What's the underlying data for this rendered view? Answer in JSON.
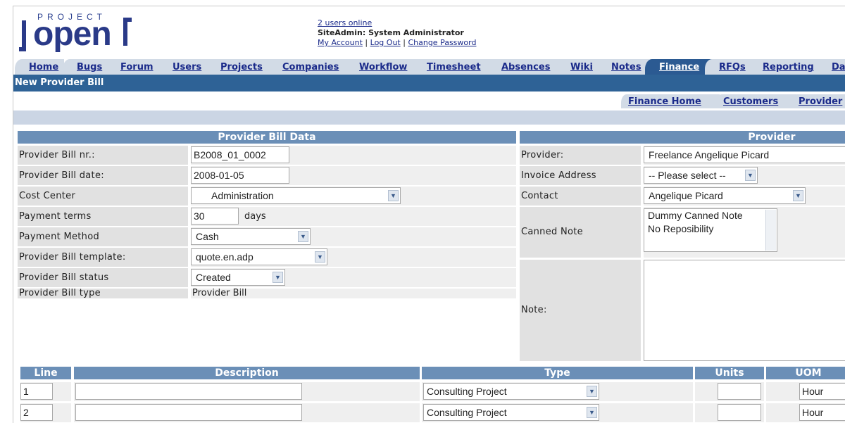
{
  "header": {
    "logo_project": "PROJECT",
    "logo_open": "open",
    "users_online": "2 users online",
    "user_line": "SiteAdmin: System Administrator",
    "my_account": "My Account",
    "logout": "Log Out",
    "change_password": "Change Password",
    "sep": "|"
  },
  "tabs": [
    {
      "label": "Home"
    },
    {
      "label": "Bugs"
    },
    {
      "label": "Forum"
    },
    {
      "label": "Users"
    },
    {
      "label": "Projects"
    },
    {
      "label": "Companies"
    },
    {
      "label": "Workflow"
    },
    {
      "label": "Timesheet"
    },
    {
      "label": "Absences"
    },
    {
      "label": "Wiki"
    },
    {
      "label": "Notes"
    },
    {
      "label": "Finance"
    },
    {
      "label": "RFQs"
    },
    {
      "label": "Reporting"
    },
    {
      "label": "Da"
    }
  ],
  "page_title": "New Provider Bill",
  "subtabs": [
    {
      "label": "Finance Home"
    },
    {
      "label": "Customers"
    },
    {
      "label": "Provider"
    }
  ],
  "bill_data": {
    "header": "Provider Bill Data",
    "nr_label": "Provider Bill nr.:",
    "nr_value": "B2008_01_0002",
    "date_label": "Provider Bill date:",
    "date_value": "2008-01-05",
    "cost_center_label": "Cost Center",
    "cost_center_value": "Administration",
    "payment_terms_label": "Payment terms",
    "payment_terms_value": "30",
    "payment_terms_unit": "days",
    "payment_method_label": "Payment Method",
    "payment_method_value": "Cash",
    "template_label": "Provider Bill template:",
    "template_value": "quote.en.adp",
    "status_label": "Provider Bill status",
    "status_value": "Created",
    "type_label": "Provider Bill type",
    "type_value": "Provider Bill"
  },
  "provider": {
    "header": "Provider",
    "provider_label": "Provider:",
    "provider_value": "Freelance Angelique Picard",
    "invoice_address_label": "Invoice Address",
    "invoice_address_value": "-- Please select --",
    "contact_label": "Contact",
    "contact_value": "Angelique Picard",
    "canned_note_label": "Canned Note",
    "canned_note_line1": "Dummy Canned Note",
    "canned_note_line2": "No Reposibility",
    "note_label": "Note:"
  },
  "lines": {
    "headers": {
      "line": "Line",
      "description": "Description",
      "type": "Type",
      "units": "Units",
      "uom": "UOM"
    },
    "rows": [
      {
        "line": "1",
        "description": "",
        "type": "Consulting Project",
        "units": "",
        "uom": "Hour"
      },
      {
        "line": "2",
        "description": "",
        "type": "Consulting Project",
        "units": "",
        "uom": "Hour"
      }
    ]
  },
  "colors": {
    "title_bar": "#2e6296",
    "panel_header": "#6b8fb7",
    "active_tab": "#2b5a92",
    "tab": "#d2dbe6",
    "link": "#1a2a8a"
  },
  "icons": {
    "dropdown": "chevron-down-icon"
  }
}
